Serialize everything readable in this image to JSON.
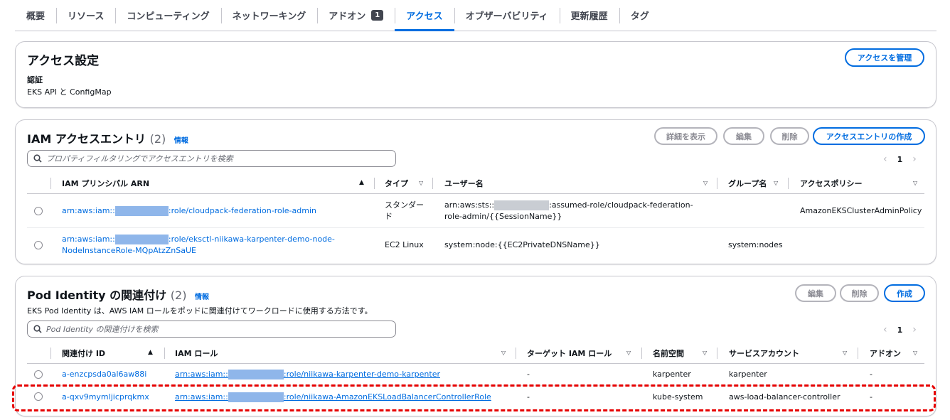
{
  "tabs": [
    {
      "label": "概要"
    },
    {
      "label": "リソース"
    },
    {
      "label": "コンピューティング"
    },
    {
      "label": "ネットワーキング"
    },
    {
      "label": "アドオン",
      "badge": "1"
    },
    {
      "label": "アクセス",
      "active": true
    },
    {
      "label": "オブザーバビリティ"
    },
    {
      "label": "更新履歴"
    },
    {
      "label": "タグ"
    }
  ],
  "access_settings": {
    "title": "アクセス設定",
    "manage_button": "アクセスを管理",
    "auth_label": "認証",
    "auth_value": "EKS API と ConfigMap"
  },
  "iam_entries": {
    "title": "IAM アクセスエントリ",
    "count": "(2)",
    "info": "情報",
    "buttons": {
      "details": "詳細を表示",
      "edit": "編集",
      "delete": "削除",
      "create": "アクセスエントリの作成"
    },
    "search_placeholder": "プロパティフィルタリングでアクセスエントリを検索",
    "page": "1",
    "columns": [
      "IAM プリンシパル ARN",
      "タイプ",
      "ユーザー名",
      "グループ名",
      "アクセスポリシー"
    ],
    "rows": [
      {
        "arn_prefix": "arn:aws:iam::",
        "arn_suffix": ":role/cloudpack-federation-role-admin",
        "type": "スタンダード",
        "user_prefix": "arn:aws:sts::",
        "user_suffix": ":assumed-role/cloudpack-federation-role-admin/{{SessionName}}",
        "group": "",
        "policy": "AmazonEKSClusterAdminPolicy"
      },
      {
        "arn_prefix": "arn:aws:iam::",
        "arn_suffix": ":role/eksctl-niikawa-karpenter-demo-node-NodeInstanceRole-MQpAtzZnSaUE",
        "type": "EC2 Linux",
        "user": "system:node:{{EC2PrivateDNSName}}",
        "group": "system:nodes",
        "policy": ""
      }
    ]
  },
  "pod_identity": {
    "title": "Pod Identity の関連付け",
    "count": "(2)",
    "info": "情報",
    "description": "EKS Pod Identity は、AWS IAM ロールをポッドに関連付けてワークロードに使用する方法です。",
    "buttons": {
      "edit": "編集",
      "delete": "削除",
      "create": "作成"
    },
    "search_placeholder": "Pod Identity の関連付けを検索",
    "page": "1",
    "columns": [
      "関連付け ID",
      "IAM ロール",
      "ターゲット IAM ロール",
      "名前空間",
      "サービスアカウント",
      "アドオン"
    ],
    "rows": [
      {
        "id": "a-enzcpsda0al6aw88i",
        "role_prefix": "arn:aws:iam::",
        "role_suffix": ":role/niikawa-karpenter-demo-karpenter",
        "target": "-",
        "namespace": "karpenter",
        "service_account": "karpenter",
        "addon": "-"
      },
      {
        "id": "a-qxv9mymljicprqkmx",
        "role_prefix": "arn:aws:iam::",
        "role_suffix": ":role/niikawa-AmazonEKSLoadBalancerControllerRole",
        "target": "-",
        "namespace": "kube-system",
        "service_account": "aws-load-balancer-controller",
        "addon": "-"
      }
    ]
  },
  "colors": {
    "accent": "#006ce0",
    "highlight": "#e60000",
    "text": "#0f141a",
    "border": "#c6c6cd"
  },
  "icons": [
    "search-icon",
    "chevron-left-icon",
    "chevron-right-icon",
    "sort-ascending-icon",
    "sort-descending-icon"
  ]
}
